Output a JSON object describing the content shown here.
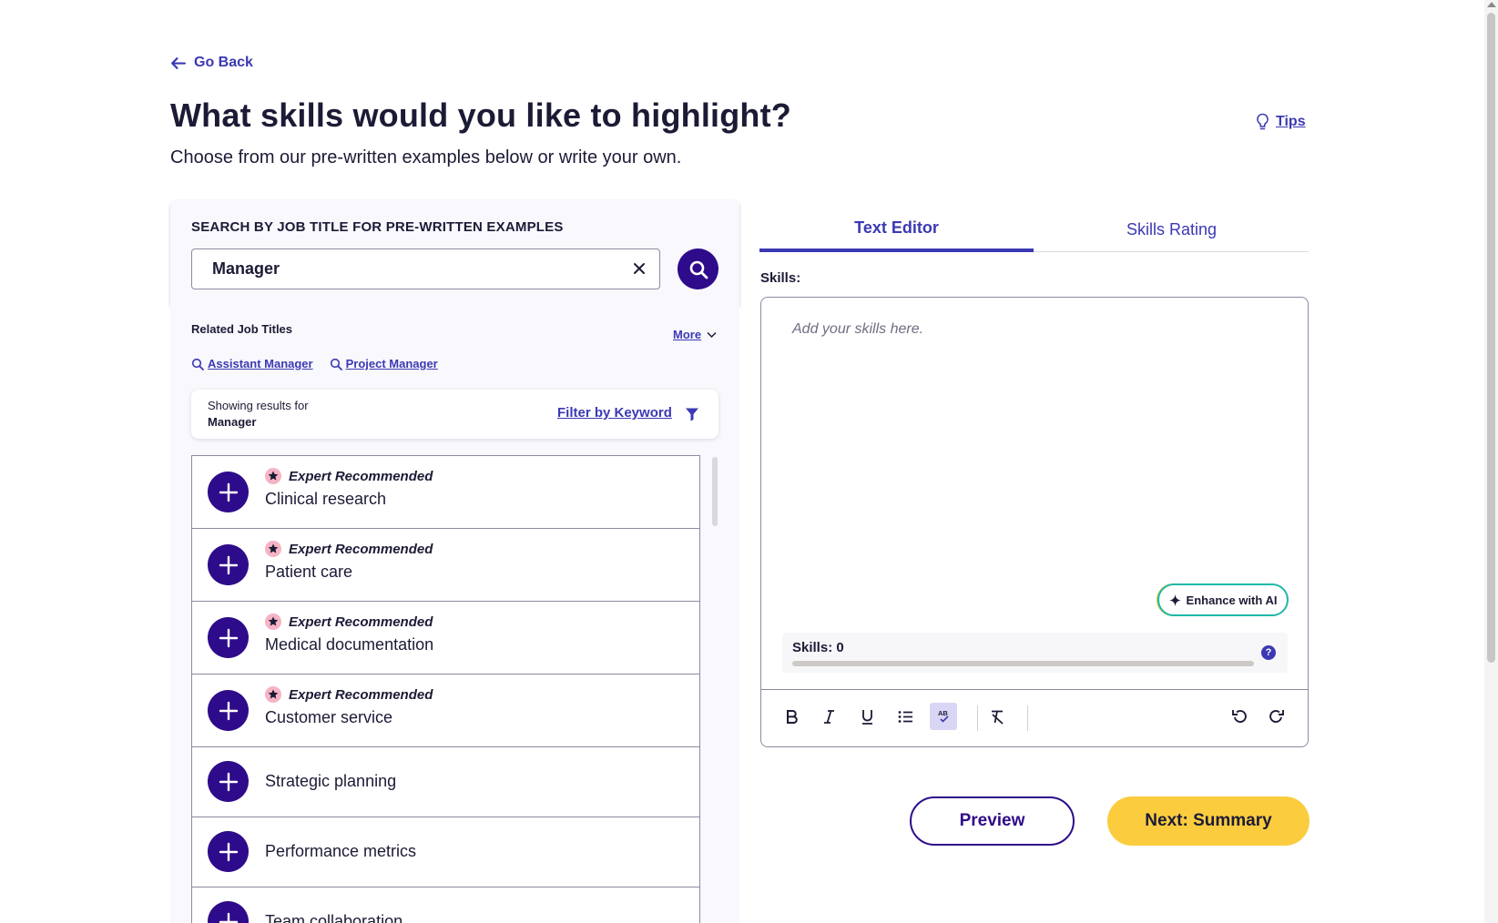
{
  "nav": {
    "go_back": "Go Back",
    "tips": "Tips"
  },
  "header": {
    "title": "What skills would you like to highlight?",
    "subtitle": "Choose from our pre-written examples below or write your own."
  },
  "search": {
    "label": "SEARCH BY JOB TITLE FOR PRE-WRITTEN EXAMPLES",
    "value": "Manager",
    "placeholder": ""
  },
  "related": {
    "label": "Related Job Titles",
    "more": "More",
    "links": [
      "Assistant Manager",
      "Project Manager"
    ]
  },
  "results": {
    "showing_label": "Showing results for",
    "showing_value": "Manager",
    "filter": "Filter by Keyword"
  },
  "examples": [
    {
      "badge": "Expert Recommended",
      "text": "Clinical research"
    },
    {
      "badge": "Expert Recommended",
      "text": "Patient care"
    },
    {
      "badge": "Expert Recommended",
      "text": "Medical documentation"
    },
    {
      "badge": "Expert Recommended",
      "text": "Customer service"
    },
    {
      "badge": "",
      "text": "Strategic planning"
    },
    {
      "badge": "",
      "text": "Performance metrics"
    },
    {
      "badge": "",
      "text": "Team collaboration"
    }
  ],
  "editor": {
    "tabs": [
      "Text Editor",
      "Skills Rating"
    ],
    "active_tab": "Text Editor",
    "label": "Skills:",
    "placeholder": "Add your skills here.",
    "enhance": "Enhance with AI",
    "meter_label": "Skills: 0",
    "meter_value": 0,
    "help": "?",
    "spell_icon_text": "AB"
  },
  "actions": {
    "preview": "Preview",
    "next": "Next: Summary"
  },
  "colors": {
    "primary": "#2e0b8a",
    "link": "#3b39b3",
    "accent_yellow": "#fbcd3e",
    "badge_pink": "#f6b4c4",
    "ai_border": "#1fb8a8"
  },
  "icons": [
    "arrow-left-icon",
    "lightbulb-icon",
    "close-icon",
    "search-icon",
    "chevron-down-icon",
    "filter-icon",
    "plus-icon",
    "star-icon",
    "sparkle-icon",
    "bold-icon",
    "italic-icon",
    "underline-icon",
    "bullet-list-icon",
    "spellcheck-icon",
    "clear-format-icon",
    "undo-icon",
    "redo-icon"
  ]
}
